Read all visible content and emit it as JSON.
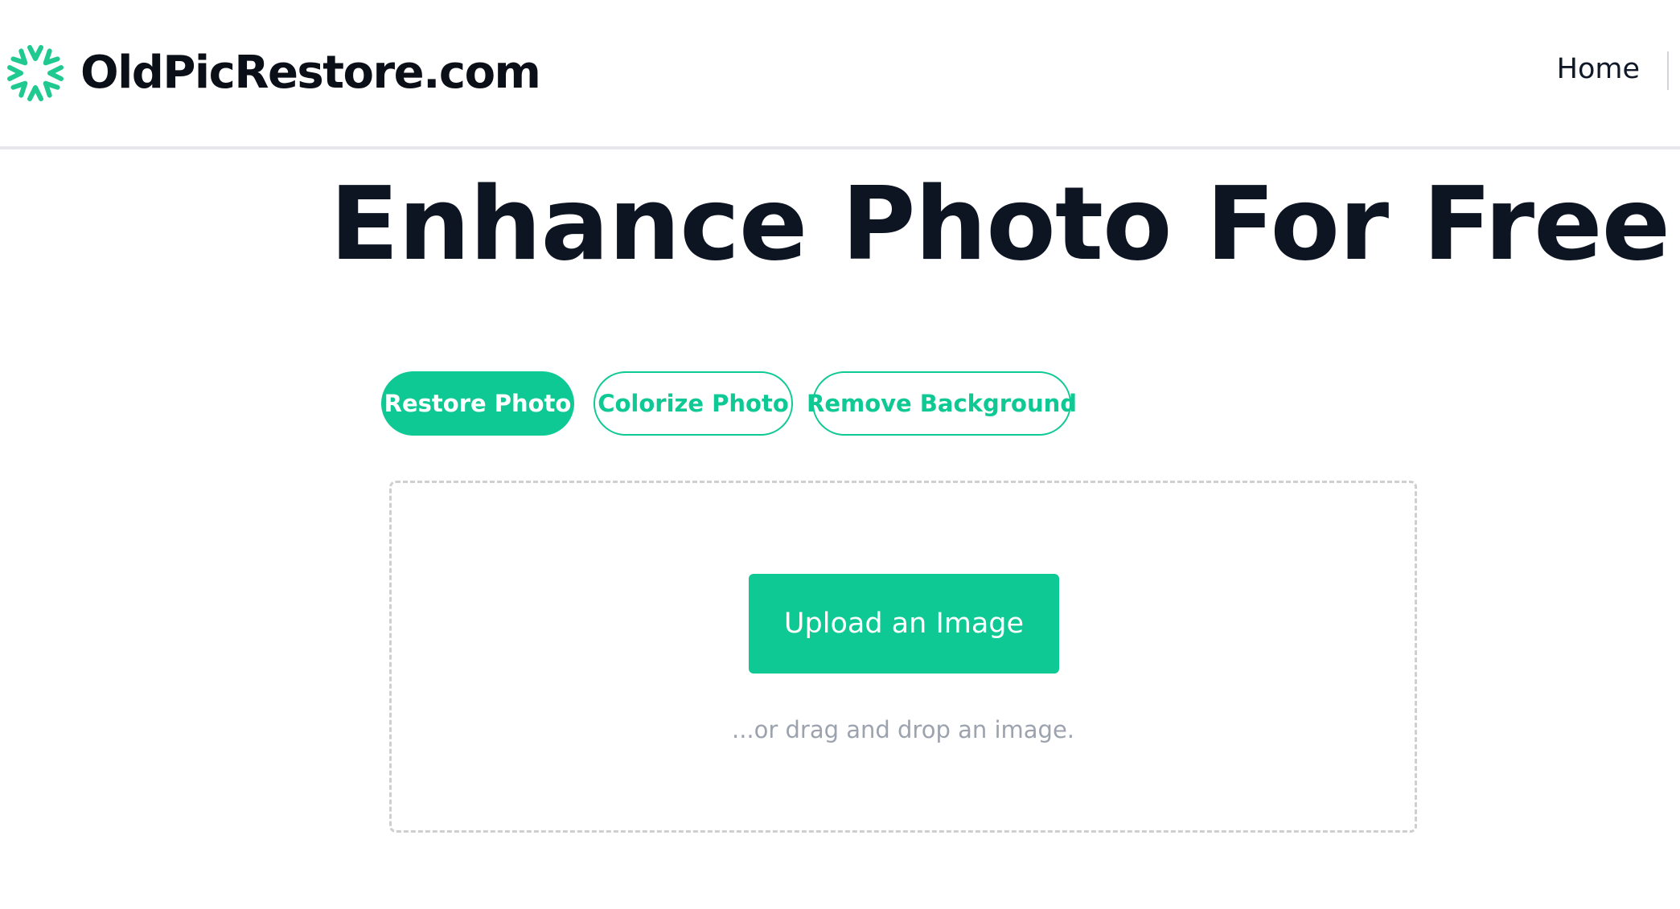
{
  "header": {
    "site_name": "OldPicRestore.com",
    "logo_icon": "sunburst-logo-icon",
    "nav": {
      "home_label": "Home"
    }
  },
  "hero": {
    "title": "Enhance Photo For Free"
  },
  "tabs": [
    {
      "label": "Restore Photo",
      "active": true
    },
    {
      "label": "Colorize Photo",
      "active": false
    },
    {
      "label": "Remove Background",
      "active": false
    }
  ],
  "upload": {
    "button_label": "Upload an Image",
    "hint": "...or drag and drop an image."
  },
  "colors": {
    "accent": "#0ec993",
    "title": "#0d1422",
    "hint": "#9ca3af",
    "border": "#cfcfcf"
  }
}
